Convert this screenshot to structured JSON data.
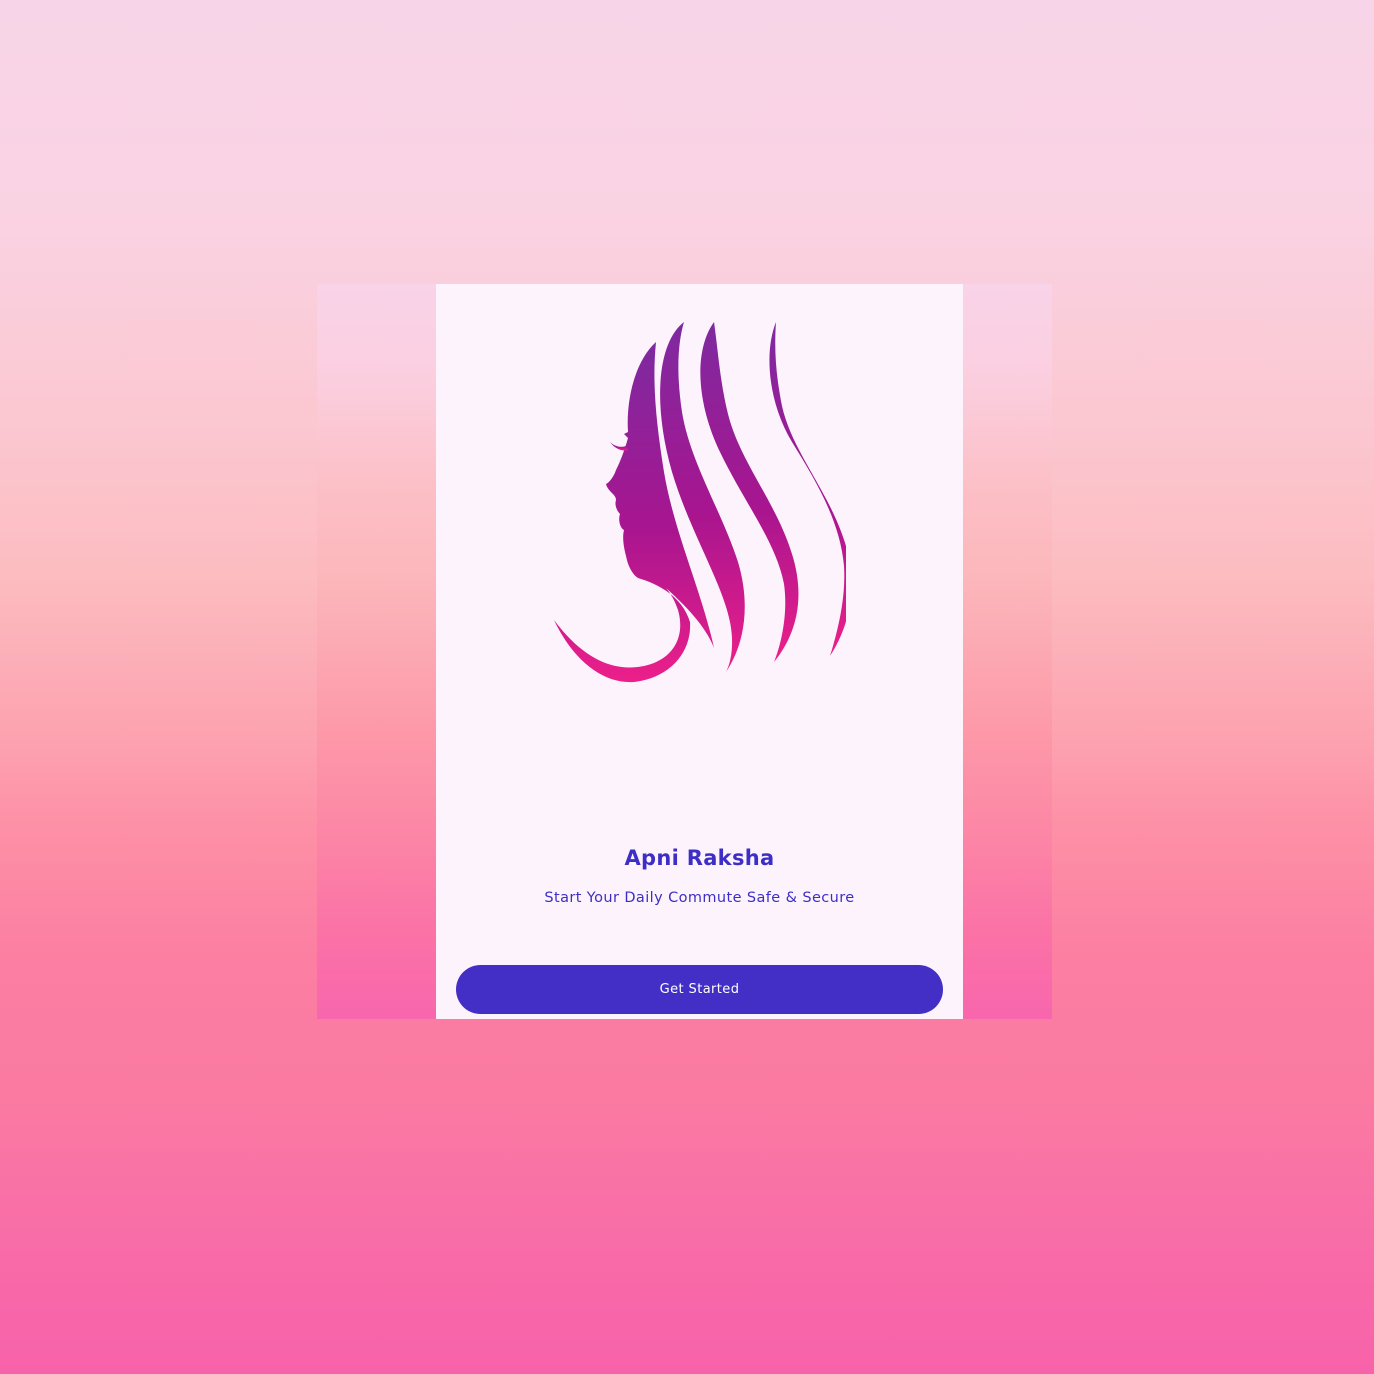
{
  "app": {
    "title": "Apni Raksha",
    "tagline": "Start Your Daily Commute Safe & Secure"
  },
  "actions": {
    "get_started_label": "Get Started"
  },
  "logo": {
    "icon": "woman-silhouette-icon",
    "gradient_top": "#7e2aa0",
    "gradient_bottom": "#ec1f8a"
  },
  "colors": {
    "accent": "#432ec6",
    "text": "#3d2fc5",
    "screen_background": "#fdf3fc"
  }
}
